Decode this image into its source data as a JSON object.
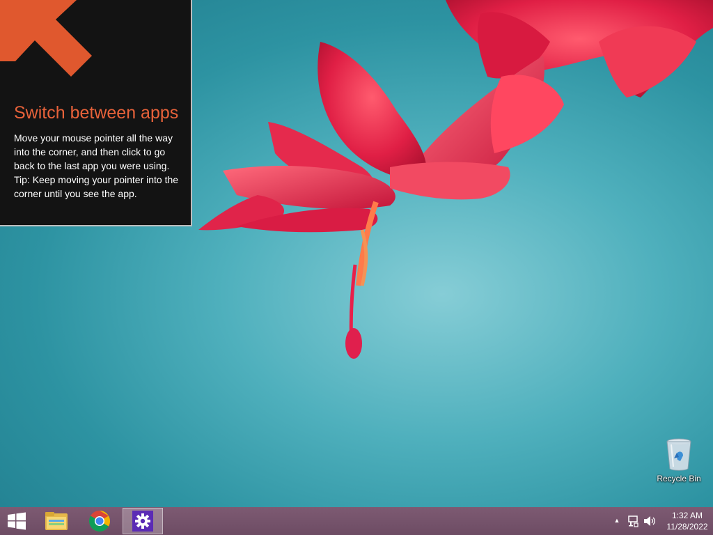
{
  "tip": {
    "title": "Switch between apps",
    "line1": "Move your mouse pointer all the way into the corner, and then click to go back to the last app you were using.",
    "line2": "Tip: Keep moving your pointer into the corner until you see the app.",
    "arrow_icon": "arrow-up-left-icon",
    "accent_color": "#e8623a"
  },
  "desktop": {
    "icons": [
      {
        "label": "Recycle Bin",
        "icon": "recycle-bin-icon"
      }
    ]
  },
  "taskbar": {
    "start_icon": "windows-logo-icon",
    "apps": [
      {
        "name": "File Explorer",
        "icon": "folder-icon",
        "active": false
      },
      {
        "name": "Google Chrome",
        "icon": "chrome-icon",
        "active": false
      },
      {
        "name": "Settings",
        "icon": "gear-icon",
        "active": true
      }
    ],
    "tray": {
      "chevron": "▲",
      "time": "1:32 AM",
      "date": "11/28/2022"
    },
    "color": "#6d4c64"
  }
}
